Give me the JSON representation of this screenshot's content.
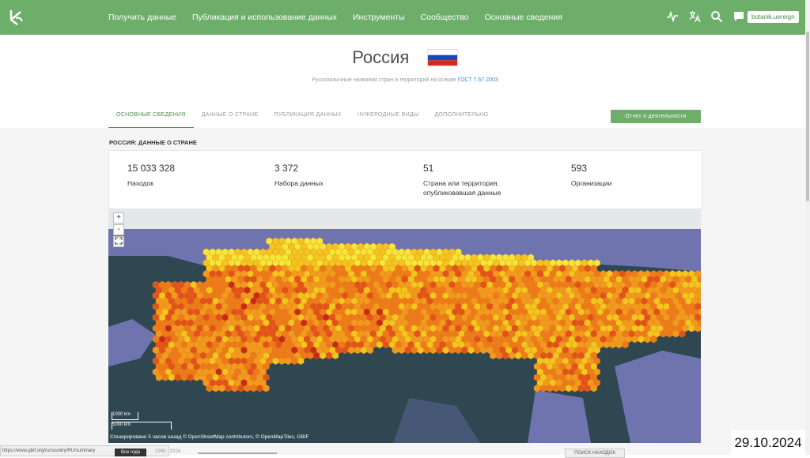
{
  "topbar": {
    "nav": [
      "Получить данные",
      "Публикация и использование данных",
      "Инструменты",
      "Сообщество",
      "Основные сведения"
    ],
    "user": "botanik.uereign",
    "icons": [
      "logo-icon",
      "activity-icon",
      "translate-icon",
      "search-icon",
      "chat-icon"
    ]
  },
  "header": {
    "title": "Россия",
    "subtitle": "Русскоязычные названия стран и территорий на основе",
    "subtitle_link": "ГОСТ 7.67 2003"
  },
  "tabs": [
    "Основные сведения",
    "Данные о стране",
    "Публикация данных",
    "Чужеродные виды",
    "Дополнительно"
  ],
  "report_button": "Отчет о деятельности",
  "section_label": "РОССИЯ: ДАННЫЕ О СТРАНЕ",
  "stats": [
    {
      "num": "15 033 328",
      "label": "Находок"
    },
    {
      "num": "3 372",
      "label": "Набора данных"
    },
    {
      "num": "51",
      "label": "Страна или территория, опубликовавшая данные"
    },
    {
      "num": "593",
      "label": "Организации"
    }
  ],
  "map": {
    "zoom_in": "+",
    "zoom_out": "-",
    "scale_km": "1000 km",
    "scale_km2": "5000 km",
    "attribution": "Сгенерировано 5 часов назад © OpenStreetMap contributors, © OpenMapTiles, GBIF"
  },
  "statusbar": "https://www.gbif.org/ru/country/RU/summary",
  "bottom": {
    "all_years": "Все года",
    "years": "1998 - 2024",
    "search_button": "ПОИСК НАХОДОК"
  },
  "date_stamp": "29.10.2024"
}
